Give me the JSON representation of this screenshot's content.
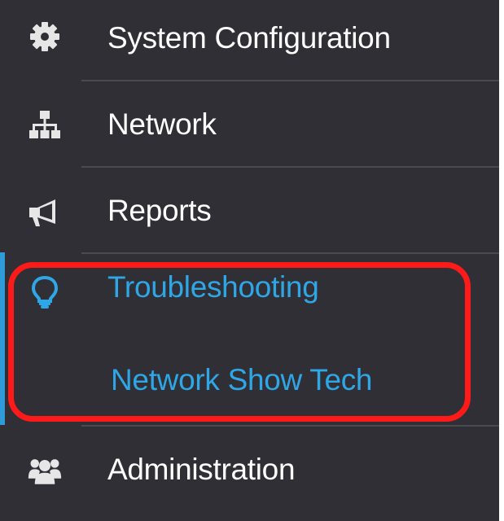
{
  "colors": {
    "sidebar_bg": "#2f2f35",
    "text": "#ffffff",
    "active_accent": "#2fa6e6",
    "highlight_border": "#ff1a1a",
    "divider": "#4a4a52"
  },
  "nav": {
    "items": [
      {
        "label": "System Configuration",
        "icon": "gear-icon"
      },
      {
        "label": "Network",
        "icon": "network-icon"
      },
      {
        "label": "Reports",
        "icon": "megaphone-icon"
      },
      {
        "label": "Troubleshooting",
        "icon": "lightbulb-icon",
        "active": true
      },
      {
        "label": "Administration",
        "icon": "users-icon"
      }
    ],
    "troubleshooting_sub": {
      "items": [
        {
          "label": "Network Show Tech"
        }
      ]
    }
  }
}
